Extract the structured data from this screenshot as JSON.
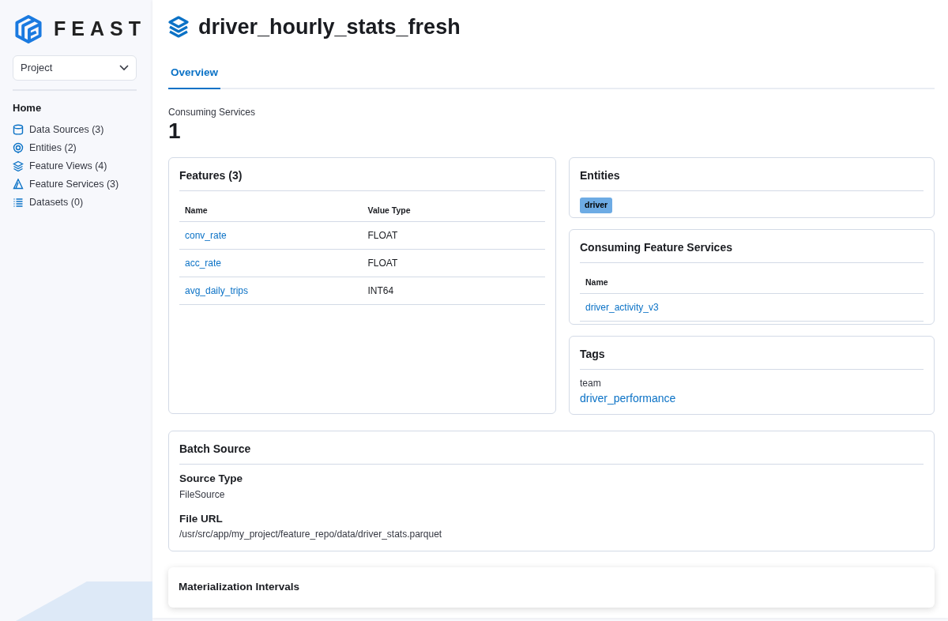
{
  "sidebar": {
    "logo_text": "FEAST",
    "project_select": {
      "value": "Project"
    },
    "nav_heading": "Home",
    "items": [
      {
        "label": "Data Sources (3)"
      },
      {
        "label": "Entities (2)"
      },
      {
        "label": "Feature Views (4)"
      },
      {
        "label": "Feature Services (3)"
      },
      {
        "label": "Datasets (0)"
      }
    ]
  },
  "page_title": "driver_hourly_stats_fresh",
  "tabs": [
    {
      "label": "Overview",
      "selected": true
    }
  ],
  "stat": {
    "label": "Consuming Services",
    "value": "1"
  },
  "features": {
    "title": "Features (3)",
    "columns": [
      "Name",
      "Value Type"
    ],
    "rows": [
      [
        "conv_rate",
        "FLOAT"
      ],
      [
        "acc_rate",
        "FLOAT"
      ],
      [
        "avg_daily_trips",
        "INT64"
      ]
    ]
  },
  "entities": {
    "title": "Entities",
    "badges": [
      "driver"
    ]
  },
  "consuming_feature_services": {
    "title": "Consuming Feature Services",
    "columns": [
      "Name"
    ],
    "rows": [
      [
        "driver_activity_v3"
      ]
    ]
  },
  "tags": {
    "title": "Tags",
    "items": [
      {
        "key": "team",
        "value": "driver_performance"
      }
    ]
  },
  "batch_source": {
    "title": "Batch Source",
    "fields": [
      {
        "label": "Source Type",
        "value": "FileSource"
      },
      {
        "label": "File URL",
        "value": "/usr/src/app/my_project/feature_repo/data/driver_stats.parquet"
      }
    ]
  },
  "materialization": {
    "title": "Materialization Intervals"
  }
}
